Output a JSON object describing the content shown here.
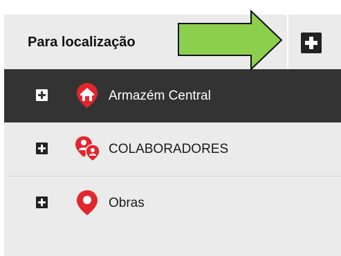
{
  "panel": {
    "title": "Para localização",
    "add_button_icon": "plus-icon"
  },
  "tree": {
    "items": [
      {
        "label": "Armazém Central",
        "icon": "warehouse-pin-icon",
        "selected": true
      },
      {
        "label": "COLABORADORES",
        "icon": "people-pin-icon",
        "selected": false
      },
      {
        "label": "Obras",
        "icon": "location-pin-icon",
        "selected": false
      }
    ]
  },
  "colors": {
    "pin_red": "#e3262e",
    "selected_row": "#333333",
    "arrow_fill": "#8ccf4d",
    "arrow_stroke": "#111111"
  }
}
